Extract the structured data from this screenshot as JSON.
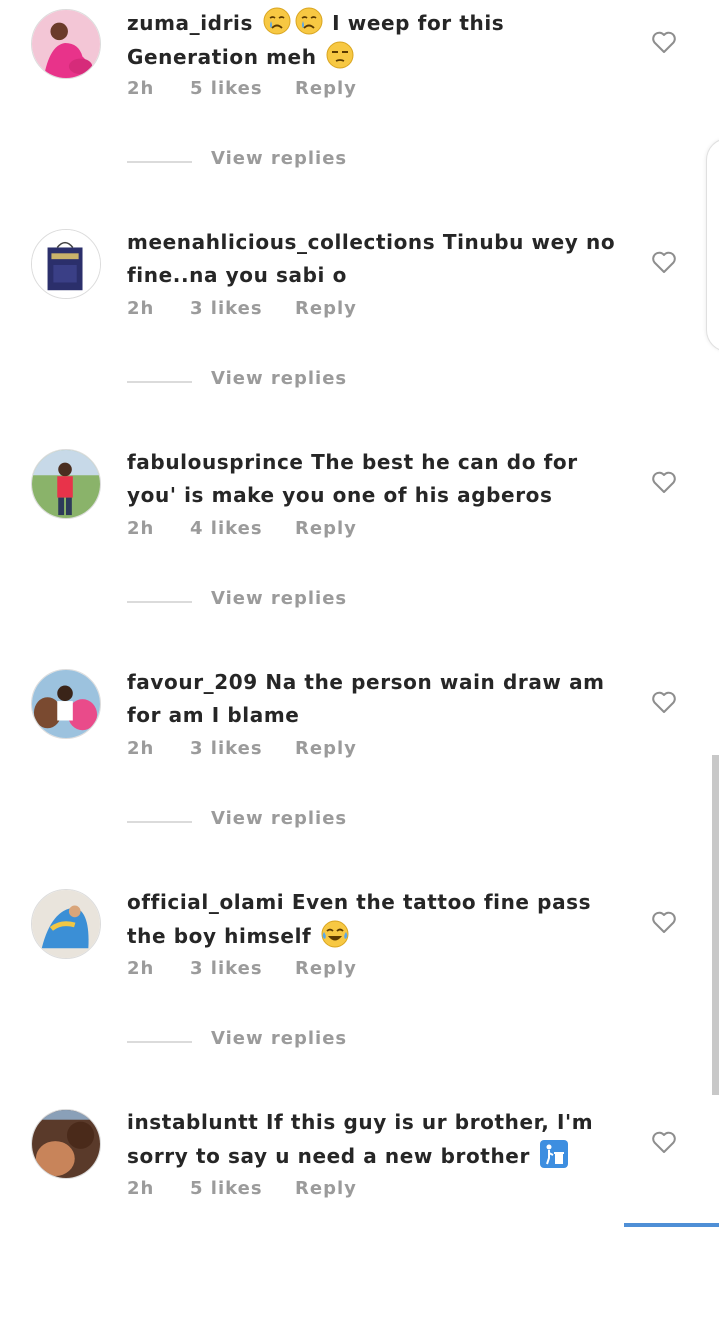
{
  "comments": [
    {
      "username": "zuma_idris",
      "pre_emoji_text": "",
      "emojis_before": [
        "crying-face-emoji",
        "crying-face-emoji"
      ],
      "text": "I weep for this Generation meh",
      "emojis_after": [
        "unamused-face-emoji"
      ],
      "time": "2h",
      "likes": "5 likes",
      "reply": "Reply",
      "view_replies": "View replies"
    },
    {
      "username": "meenahlicious_collections",
      "text": "Tinubu wey no fine..na you sabi o",
      "time": "2h",
      "likes": "3 likes",
      "reply": "Reply",
      "view_replies": "View replies"
    },
    {
      "username": "fabulousprince",
      "text": "The best he can do for you' is make you one of his agberos",
      "time": "2h",
      "likes": "4 likes",
      "reply": "Reply",
      "view_replies": "View replies"
    },
    {
      "username": "favour_209",
      "text": "Na the person wain draw am for am I blame",
      "time": "2h",
      "likes": "3 likes",
      "reply": "Reply",
      "view_replies": "View replies"
    },
    {
      "username": "official_olami",
      "text": "Even the tattoo fine pass the boy himself",
      "emojis_after": [
        "face-with-tears-of-joy-emoji"
      ],
      "time": "2h",
      "likes": "3 likes",
      "reply": "Reply",
      "view_replies": "View replies"
    },
    {
      "username": "instabluntt",
      "text": "If this guy is ur brother, I'm sorry to say u need a new brother",
      "emojis_after": [
        "litter-in-bin-emoji"
      ],
      "time": "2h",
      "likes": "5 likes",
      "reply": "Reply"
    }
  ],
  "icons": {
    "like": "heart-outline-icon"
  },
  "colors": {
    "text": "#262626",
    "meta": "#9b9b9b",
    "divider": "#dbdbdb",
    "accent_bar": "#4f8fd6"
  }
}
